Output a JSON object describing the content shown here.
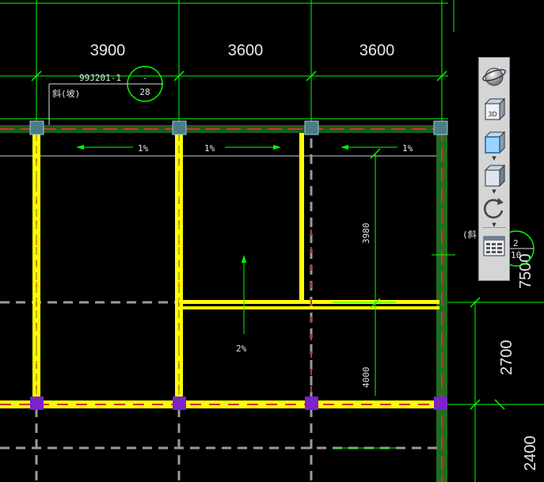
{
  "drawing": {
    "dimensions_top": [
      "3900",
      "3600",
      "3600"
    ],
    "dimensions_right": [
      "7500",
      "2700",
      "2400"
    ],
    "dimension_vertical_1": "3980",
    "dimension_vertical_2": "4000",
    "callout": {
      "reference": "99J201-1",
      "sheet": "28",
      "dash": "-",
      "label": "斜(坡)"
    },
    "right_callout": {
      "top": "2",
      "bottom": "10",
      "bracket": "(斜"
    },
    "slopes": {
      "left": "1%",
      "middle": "1%",
      "right": "1%",
      "center": "2%"
    },
    "colors": {
      "grid": "#00ff00",
      "beam": "#ffff00",
      "column_top": "#4a7d86",
      "column_bottom": "#7a22cc",
      "wall": "#00b000"
    }
  },
  "toolbar": {
    "icons": [
      "orbit-sphere-icon",
      "3d-view-icon",
      "front-view-icon",
      "iso-view-icon",
      "rotate-icon",
      "properties-panel-icon"
    ],
    "view_3d_label": "3D"
  }
}
